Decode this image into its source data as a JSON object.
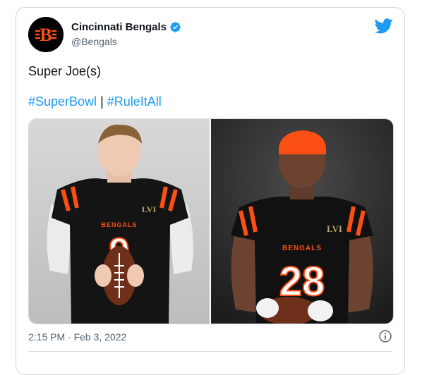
{
  "tweet": {
    "author_name": "Cincinnati Bengals",
    "author_handle": "@Bengals",
    "text": "Super Joe(s)",
    "hashtags": [
      "#SuperBowl",
      "#RuleItAll"
    ],
    "separator": "|",
    "timestamp": "2:15 PM · Feb 3, 2022",
    "avatar_logo_text": "B",
    "jersey_numbers": [
      "9",
      "28"
    ],
    "jersey_word": "BENGALS",
    "patch_text": "LVI"
  },
  "colors": {
    "link": "#1d9bf0",
    "bengals_orange": "#fb4f14",
    "text": "#0f1419",
    "muted": "#536471"
  },
  "icons": {
    "verified": "verified-badge-icon",
    "twitter": "twitter-bird-icon",
    "info": "info-icon"
  }
}
